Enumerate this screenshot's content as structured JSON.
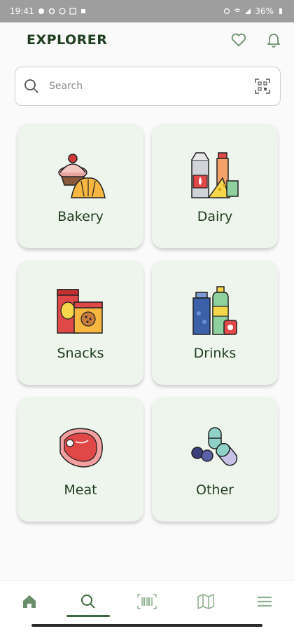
{
  "status_bar": {
    "time": "19:41",
    "battery": "36%"
  },
  "header": {
    "title": "EXPLORER",
    "favorite_icon": "heart-icon",
    "notification_icon": "bell-icon"
  },
  "search": {
    "placeholder": "Search",
    "scan_icon": "qr-scan-icon"
  },
  "categories": [
    {
      "label": "Bakery",
      "icon": "bakery-icon"
    },
    {
      "label": "Dairy",
      "icon": "dairy-icon"
    },
    {
      "label": "Snacks",
      "icon": "snacks-icon"
    },
    {
      "label": "Drinks",
      "icon": "drinks-icon"
    },
    {
      "label": "Meat",
      "icon": "meat-icon"
    },
    {
      "label": "Other",
      "icon": "pills-icon"
    }
  ],
  "bottom_nav": {
    "items": [
      {
        "icon": "home-icon",
        "active": false
      },
      {
        "icon": "search-icon",
        "active": true
      },
      {
        "icon": "barcode-icon",
        "active": false
      },
      {
        "icon": "map-icon",
        "active": false
      },
      {
        "icon": "menu-icon",
        "active": false
      }
    ]
  },
  "colors": {
    "accent": "#3d6a3d",
    "card_bg": "#eef5ec",
    "title": "#1f3d1f",
    "icon_green": "#6b8f6b"
  }
}
